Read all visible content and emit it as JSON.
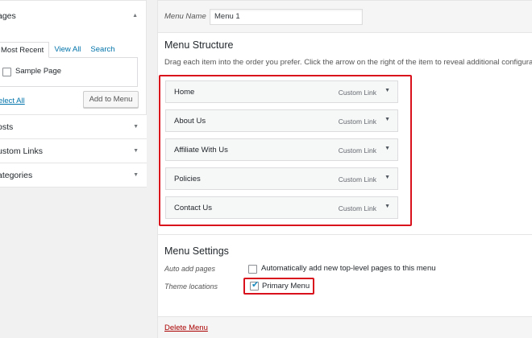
{
  "left": {
    "pages_box": {
      "title": "ages",
      "collapse_arrow": "▲",
      "tabs": [
        "Most Recent",
        "View All",
        "Search"
      ],
      "items": [
        {
          "label": "Sample Page",
          "checked": false
        }
      ],
      "select_all": "elect All",
      "add_button": "Add to Menu"
    },
    "accordion": [
      {
        "label": "osts",
        "arrow": "▼"
      },
      {
        "label": "ustom Links",
        "arrow": "▼"
      },
      {
        "label": "ategories",
        "arrow": "▼"
      }
    ]
  },
  "right": {
    "menu_name_label": "Menu Name",
    "menu_name_value": "Menu 1",
    "structure_title": "Menu Structure",
    "structure_desc": "Drag each item into the order you prefer. Click the arrow on the right of the item to reveal additional configuratio",
    "menu_items": [
      {
        "title": "Home",
        "type": "Custom Link",
        "arrow": "▼"
      },
      {
        "title": "About Us",
        "type": "Custom Link",
        "arrow": "▼"
      },
      {
        "title": "Affiliate With Us",
        "type": "Custom Link",
        "arrow": "▼"
      },
      {
        "title": "Policies",
        "type": "Custom Link",
        "arrow": "▼"
      },
      {
        "title": "Contact Us",
        "type": "Custom Link",
        "arrow": "▼"
      }
    ],
    "settings": {
      "title": "Menu Settings",
      "auto_add_label": "Auto add pages",
      "auto_add_text": "Automatically add new top-level pages to this menu",
      "auto_add_checked": false,
      "theme_locations_label": "Theme locations",
      "primary_menu_text": "Primary Menu",
      "primary_menu_checked": true,
      "check_glyph": "✔"
    },
    "delete_link": "Delete Menu"
  },
  "colors": {
    "highlight_border": "#d9111c",
    "link": "#0073aa",
    "delete": "#aa0000"
  }
}
